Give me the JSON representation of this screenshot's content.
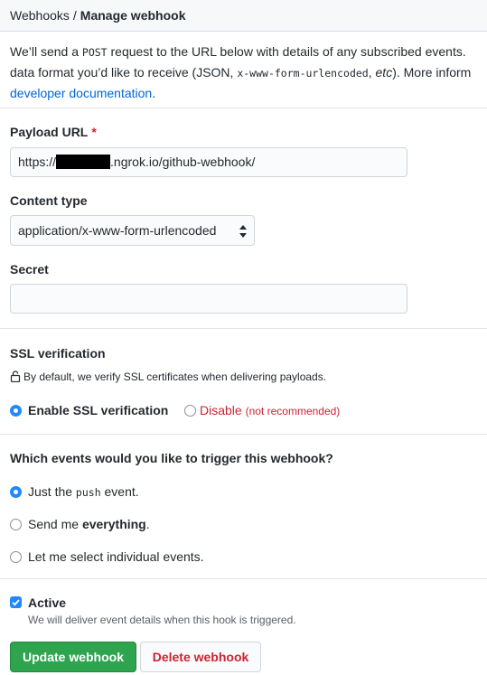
{
  "breadcrumb": {
    "parent": "Webhooks",
    "separator": "/",
    "current": "Manage webhook"
  },
  "intro": {
    "line1_pre": "We’ll send a ",
    "line1_code": "POST",
    "line1_post": " request to the URL below with details of any subscribed events. ",
    "line2_pre": "data format you’d like to receive (JSON, ",
    "line2_code": "x-www-form-urlencoded",
    "line2_mid": ", ",
    "line2_em": "etc",
    "line2_post": "). More inform",
    "link": "developer documentation",
    "link_after": "."
  },
  "payload": {
    "label": "Payload URL",
    "required_mark": "*",
    "value_prefix": "https://",
    "value_suffix": ".ngrok.io/github-webhook/"
  },
  "content_type": {
    "label": "Content type",
    "selected": "application/x-www-form-urlencoded"
  },
  "secret": {
    "label": "Secret",
    "value": ""
  },
  "ssl": {
    "label": "SSL verification",
    "note": "By default, we verify SSL certificates when delivering payloads.",
    "enable": "Enable SSL verification",
    "disable": "Disable",
    "disable_note": "(not recommended)"
  },
  "events": {
    "question": "Which events would you like to trigger this webhook?",
    "option1_pre": "Just the ",
    "option1_code": "push",
    "option1_post": " event.",
    "option2_pre": "Send me ",
    "option2_bold": "everything",
    "option2_post": ".",
    "option3": "Let me select individual events."
  },
  "active": {
    "label": "Active",
    "description": "We will deliver event details when this hook is triggered."
  },
  "buttons": {
    "update": "Update webhook",
    "delete": "Delete webhook"
  },
  "colors": {
    "accent": "#2188ff",
    "link": "#0366d6",
    "danger": "#cb2431",
    "primary_button": "#2ea44f"
  }
}
